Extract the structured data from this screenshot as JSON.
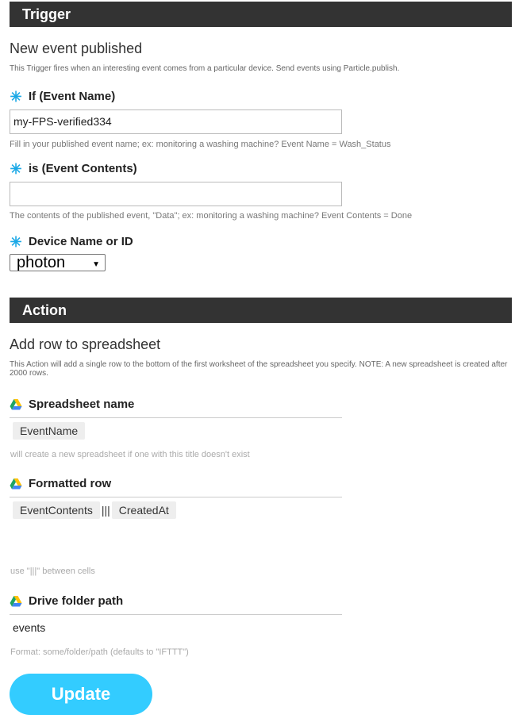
{
  "trigger": {
    "header": "Trigger",
    "title": "New event published",
    "description": "This Trigger fires when an interesting event comes from a particular device. Send events using Particle.publish.",
    "fields": {
      "event_name": {
        "label": "If (Event Name)",
        "value": "my-FPS-verified334",
        "help": "Fill in your published event name; ex: monitoring a washing machine? Event Name = Wash_Status"
      },
      "event_contents": {
        "label": "is (Event Contents)",
        "value": "",
        "help": "The contents of the published event, \"Data\"; ex: monitoring a washing machine? Event Contents = Done"
      },
      "device": {
        "label": "Device Name or ID",
        "selected": "photon"
      }
    }
  },
  "action": {
    "header": "Action",
    "title": "Add row to spreadsheet",
    "description": "This Action will add a single row to the bottom of the first worksheet of the spreadsheet you specify. NOTE: A new spreadsheet is created after 2000 rows.",
    "fields": {
      "spreadsheet_name": {
        "label": "Spreadsheet name",
        "ingredient": "EventName",
        "help": "will create a new spreadsheet if one with this title doesn't exist"
      },
      "formatted_row": {
        "label": "Formatted row",
        "ingredient_1": "EventContents",
        "separator": "|||",
        "ingredient_2": "CreatedAt",
        "help": "use \"|||\" between cells"
      },
      "drive_folder": {
        "label": "Drive folder path",
        "value": "events",
        "help": "Format: some/folder/path (defaults to \"IFTTT\")"
      }
    }
  },
  "update_button": "Update",
  "icons": {
    "required": "asterisk-icon",
    "drive": "google-drive-icon",
    "dropdown": "caret-down-icon"
  },
  "colors": {
    "header_bg": "#333333",
    "required_star": "#1aa8e6",
    "button": "#33ccff"
  }
}
